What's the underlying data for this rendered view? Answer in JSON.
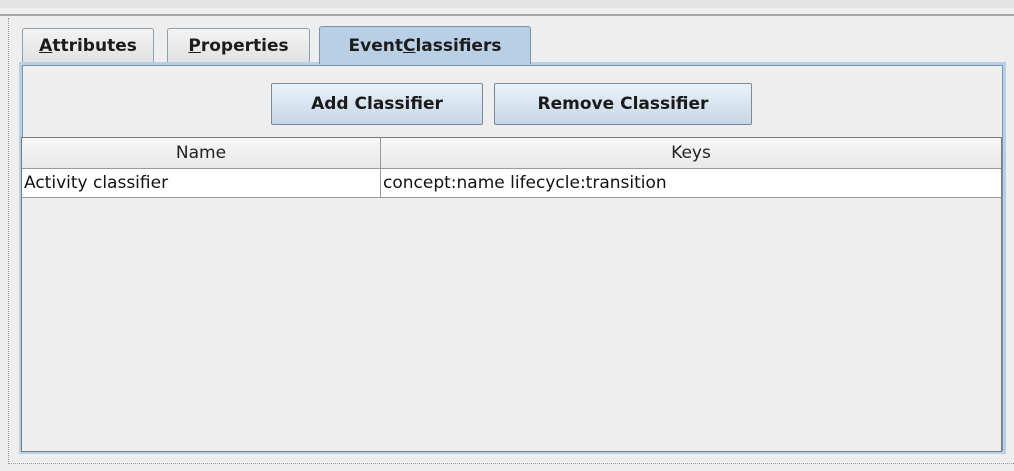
{
  "tabs": [
    {
      "label_pre": "",
      "mnemonic": "A",
      "label_post": "ttributes",
      "selected": false
    },
    {
      "label_pre": "",
      "mnemonic": "P",
      "label_post": "roperties",
      "selected": false
    },
    {
      "label_pre": "Event ",
      "mnemonic": "C",
      "label_post": "lassifiers",
      "selected": true
    }
  ],
  "toolbar": {
    "add_label": "Add Classifier",
    "remove_label": "Remove Classifier"
  },
  "table": {
    "columns": [
      "Name",
      "Keys"
    ],
    "rows": [
      {
        "name": "Activity classifier",
        "keys": "concept:name lifecycle:transition"
      }
    ]
  },
  "colors": {
    "selected_tab": "#b8cfe5",
    "panel_background": "#eeeeee",
    "button_gradient_top": "#eaf1f8",
    "button_gradient_bottom": "#c7d7e7"
  }
}
